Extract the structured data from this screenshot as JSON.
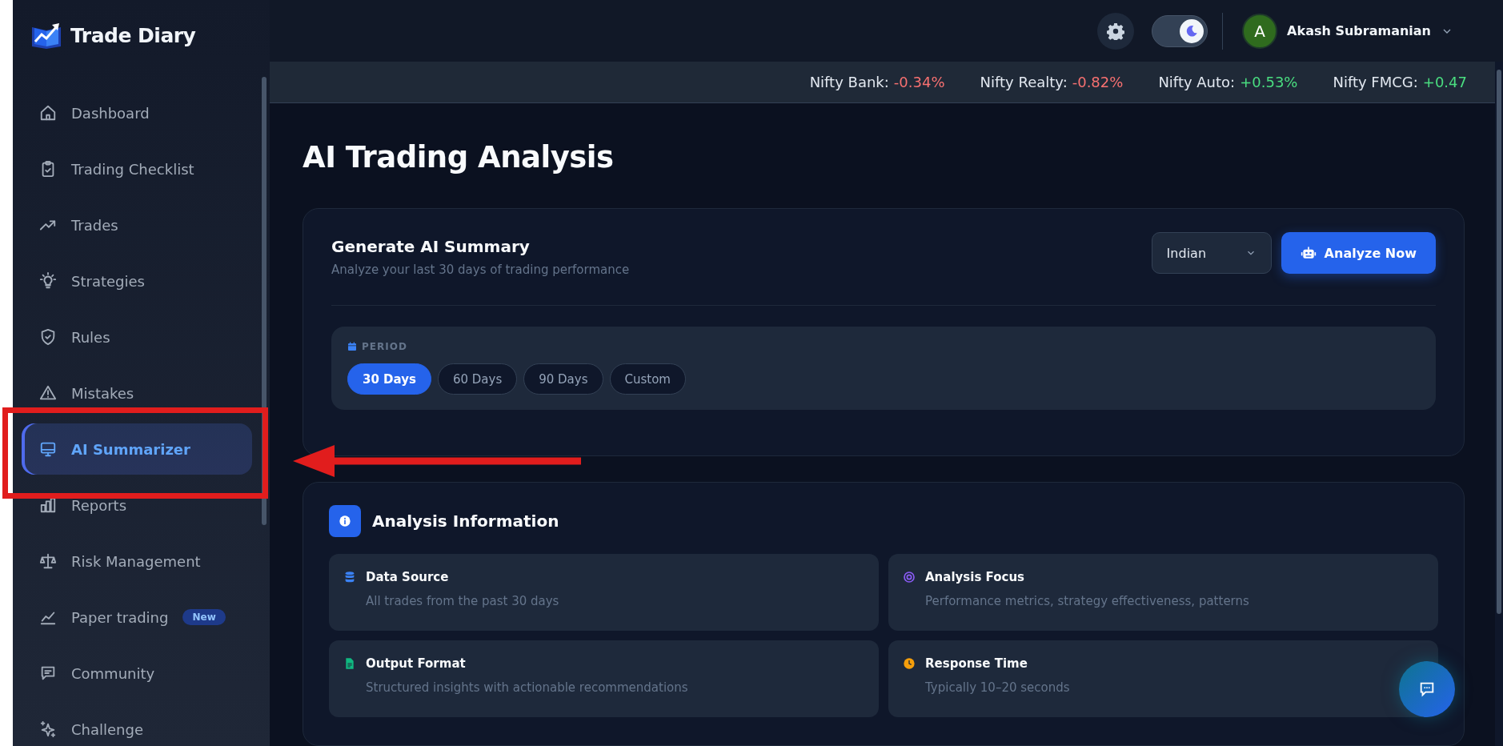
{
  "brand": {
    "name": "Trade Diary"
  },
  "sidebar": {
    "items": [
      {
        "label": "Dashboard",
        "selected": false
      },
      {
        "label": "Trading Checklist",
        "selected": false
      },
      {
        "label": "Trades",
        "selected": false
      },
      {
        "label": "Strategies",
        "selected": false
      },
      {
        "label": "Rules",
        "selected": false
      },
      {
        "label": "Mistakes",
        "selected": false
      },
      {
        "label": "AI Summarizer",
        "selected": true
      },
      {
        "label": "Reports",
        "selected": false
      },
      {
        "label": "Risk Management",
        "selected": false
      },
      {
        "label": "Paper trading",
        "selected": false,
        "badge": "New"
      },
      {
        "label": "Community",
        "selected": false
      },
      {
        "label": "Challenge",
        "selected": false
      }
    ]
  },
  "header": {
    "dark_mode": true,
    "user": {
      "initial": "A",
      "name": "Akash Subramanian"
    }
  },
  "ticker": [
    {
      "name": "Nifty Bank:",
      "change": "-0.34%",
      "color": "#f87171"
    },
    {
      "name": "Nifty Realty:",
      "change": "-0.82%",
      "color": "#f87171"
    },
    {
      "name": "Nifty Auto:",
      "change": "+0.53%",
      "color": "#4ade80"
    },
    {
      "name": "Nifty FMCG:",
      "change": "+0.47",
      "color": "#4ade80"
    }
  ],
  "page": {
    "title": "AI Trading Analysis"
  },
  "summary_card": {
    "title": "Generate AI Summary",
    "subtitle": "Analyze your last 30 days of trading performance",
    "market_select": "Indian",
    "analyze_button": "Analyze Now",
    "period": {
      "label": "PERIOD",
      "options": [
        {
          "label": "30 Days",
          "selected": true
        },
        {
          "label": "60 Days",
          "selected": false
        },
        {
          "label": "90 Days",
          "selected": false
        },
        {
          "label": "Custom",
          "selected": false
        }
      ]
    }
  },
  "info_card": {
    "title": "Analysis Information",
    "items": [
      {
        "title": "Data Source",
        "text": "All trades from the past 30 days",
        "color": "#3b82f6"
      },
      {
        "title": "Analysis Focus",
        "text": "Performance metrics, strategy effectiveness, patterns",
        "color": "#8b5cf6"
      },
      {
        "title": "Output Format",
        "text": "Structured insights with actionable recommendations",
        "color": "#10b981"
      },
      {
        "title": "Response Time",
        "text": "Typically 10–20 seconds",
        "color": "#f59e0b"
      }
    ]
  }
}
